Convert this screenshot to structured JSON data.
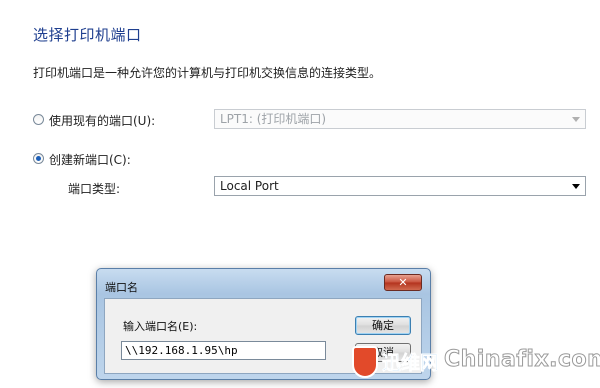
{
  "heading": "选择打印机端口",
  "description": "打印机端口是一种允许您的计算机与打印机交换信息的连接类型。",
  "options": {
    "use_existing_label": "使用现有的端口(U):",
    "use_existing_value": "LPT1: (打印机端口)",
    "create_new_label": "创建新端口(C):",
    "port_type_label": "端口类型:",
    "port_type_value": "Local Port"
  },
  "dialog": {
    "title": "端口名",
    "close_symbol": "✕",
    "field_label": "输入端口名(E):",
    "field_value": "\\\\192.168.1.95\\hp",
    "ok_label": "确定",
    "cancel_label": "取消"
  },
  "watermark": {
    "brand_cn": "迅维网",
    "brand_en": "Chinafix.com"
  },
  "colors": {
    "heading": "#1f3f8f",
    "dialog_frame": "#a9c5e2",
    "close_button": "#c8503b"
  }
}
